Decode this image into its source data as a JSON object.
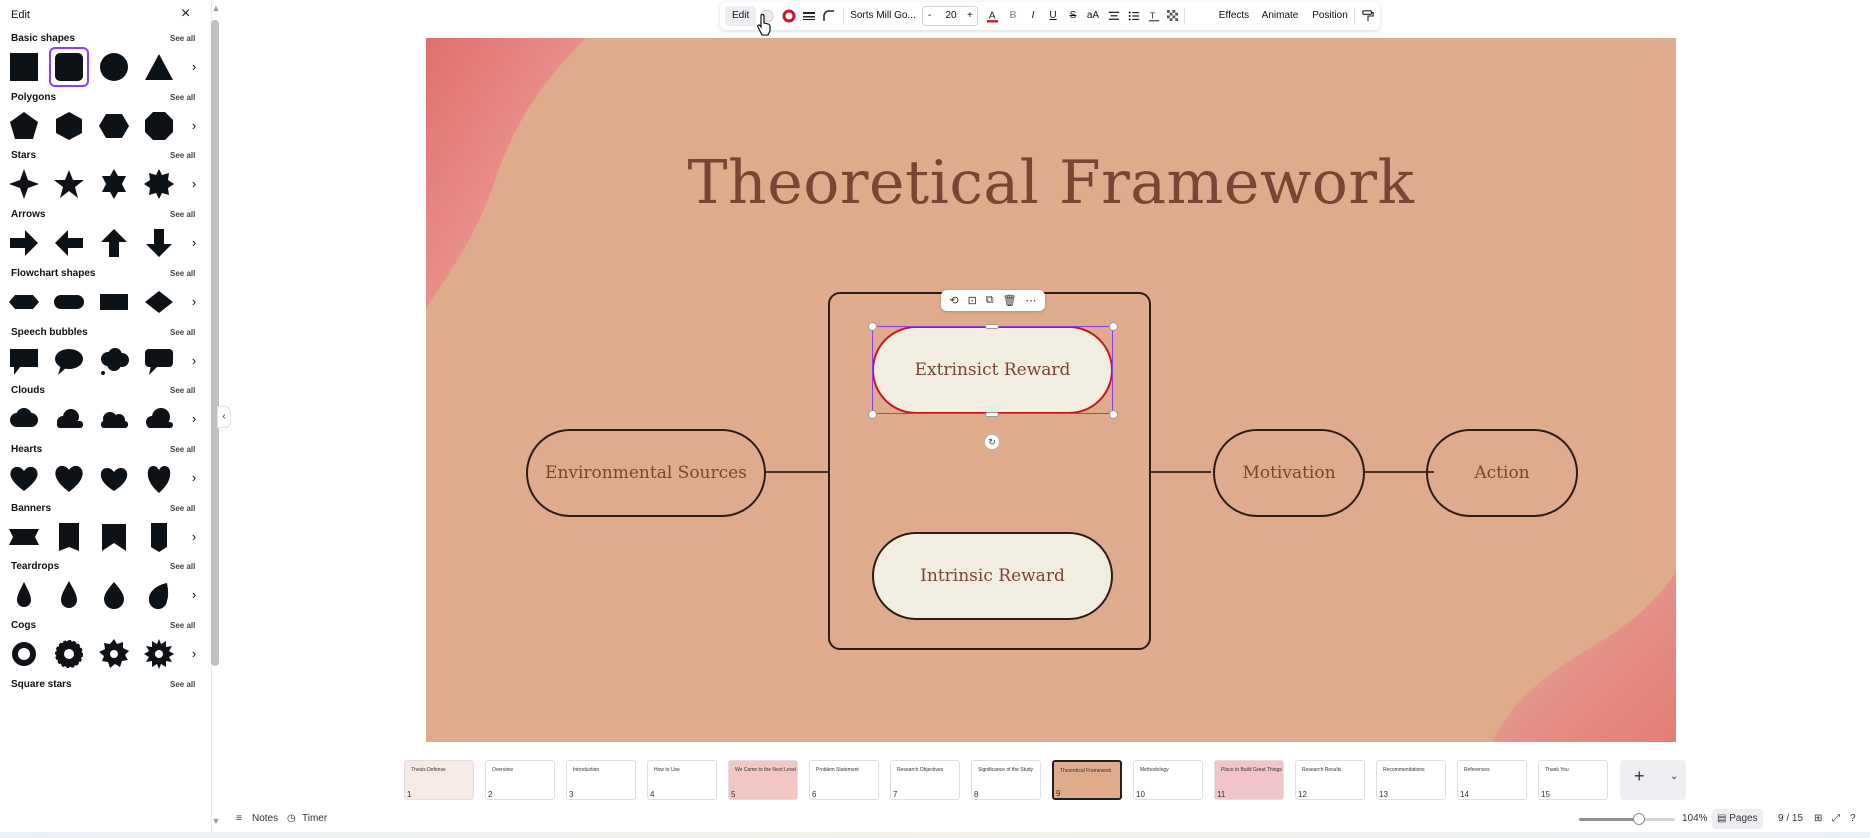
{
  "panel": {
    "title": "Edit",
    "close": "×",
    "more_arrow": "›",
    "sections": [
      {
        "title": "Basic shapes",
        "see_all": "See all",
        "shapes": [
          "square",
          "rounded-square",
          "circle",
          "triangle"
        ]
      },
      {
        "title": "Polygons",
        "see_all": "See all",
        "shapes": [
          "pentagon",
          "hexagon",
          "hexagon-wide",
          "octagon"
        ]
      },
      {
        "title": "Stars",
        "see_all": "See all",
        "shapes": [
          "star-4",
          "star-5",
          "star-6",
          "star-8"
        ]
      },
      {
        "title": "Arrows",
        "see_all": "See all",
        "shapes": [
          "arrow-right",
          "arrow-left",
          "arrow-up",
          "arrow-down"
        ]
      },
      {
        "title": "Flowchart shapes",
        "see_all": "See all",
        "shapes": [
          "flow-hexagon",
          "flow-pill",
          "flow-rect",
          "flow-diamond"
        ]
      },
      {
        "title": "Speech bubbles",
        "see_all": "See all",
        "shapes": [
          "bubble-square",
          "bubble-oval",
          "bubble-cloud",
          "bubble-rounded"
        ]
      },
      {
        "title": "Clouds",
        "see_all": "See all",
        "shapes": [
          "cloud-1",
          "cloud-2",
          "cloud-3",
          "cloud-4"
        ]
      },
      {
        "title": "Hearts",
        "see_all": "See all",
        "shapes": [
          "heart-1",
          "heart-2",
          "heart-3",
          "heart-4"
        ]
      },
      {
        "title": "Banners",
        "see_all": "See all",
        "shapes": [
          "banner-1",
          "banner-2",
          "banner-3",
          "banner-4"
        ]
      },
      {
        "title": "Teardrops",
        "see_all": "See all",
        "shapes": [
          "drop-1",
          "drop-2",
          "drop-3",
          "drop-4"
        ]
      },
      {
        "title": "Cogs",
        "see_all": "See all",
        "shapes": [
          "cog-1",
          "cog-2",
          "cog-3",
          "cog-4"
        ]
      },
      {
        "title": "Square stars",
        "see_all": "See all",
        "shapes": []
      }
    ]
  },
  "toolbar": {
    "edit_label": "Edit",
    "font_name": "Sorts Mill Go...",
    "font_size": "20",
    "minus": "-",
    "plus": "+",
    "bold": "B",
    "italic": "I",
    "underline": "U",
    "strike": "S",
    "case": "aA",
    "effects": "Effects",
    "animate": "Animate",
    "position": "Position",
    "border_color": "#c8161b"
  },
  "slide": {
    "title": "Theoretical Framework",
    "nodes": {
      "extrinsic": "Extrinsict Reward",
      "intrinsic": "Intrinsic Reward",
      "environmental": "Environmental Sources",
      "motivation": "Motivation",
      "action": "Action"
    },
    "background": "#dfab8d"
  },
  "filmstrip": {
    "pages": [
      {
        "num": "1",
        "label": "Thesis Defense"
      },
      {
        "num": "2",
        "label": "Overview"
      },
      {
        "num": "3",
        "label": "Introduction"
      },
      {
        "num": "4",
        "label": "How to Use"
      },
      {
        "num": "5",
        "label": "We Came to the Next Level"
      },
      {
        "num": "6",
        "label": "Problem Statement"
      },
      {
        "num": "7",
        "label": "Research Objectives"
      },
      {
        "num": "8",
        "label": "Significance of the Study"
      },
      {
        "num": "9",
        "label": "Theoretical Framework"
      },
      {
        "num": "10",
        "label": "Methodology"
      },
      {
        "num": "11",
        "label": "Place to Build Great Things"
      },
      {
        "num": "12",
        "label": "Research Results"
      },
      {
        "num": "13",
        "label": "Recommendations"
      },
      {
        "num": "14",
        "label": "References"
      },
      {
        "num": "15",
        "label": "Thank You"
      }
    ],
    "current": "9"
  },
  "bottombar": {
    "notes": "Notes",
    "timer": "Timer",
    "zoom": "104%",
    "zoom_level": 0.6,
    "pages": "Pages",
    "page_count": "9 / 15"
  },
  "colors": {
    "accent": "#8b3dff",
    "slide_text": "#7a4533",
    "pill_fill": "#f1ede0"
  }
}
